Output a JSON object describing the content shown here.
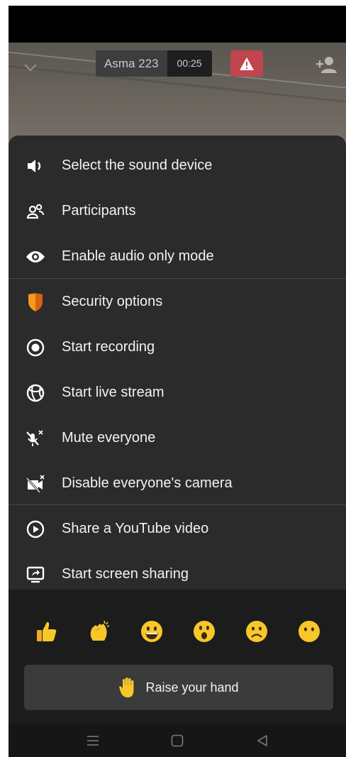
{
  "call": {
    "participant_name": "Asma 223",
    "timer": "00:25"
  },
  "menu": {
    "items": [
      {
        "label": "Select the sound device",
        "icon": "speaker-icon"
      },
      {
        "label": "Participants",
        "icon": "participants-icon"
      },
      {
        "label": "Enable audio only mode",
        "icon": "eye-icon"
      },
      {
        "label": "Security options",
        "icon": "shield-icon"
      },
      {
        "label": "Start recording",
        "icon": "record-icon"
      },
      {
        "label": "Start live stream",
        "icon": "live-stream-icon"
      },
      {
        "label": "Mute everyone",
        "icon": "mic-off-icon"
      },
      {
        "label": "Disable everyone's camera",
        "icon": "camera-off-icon"
      },
      {
        "label": "Share a YouTube video",
        "icon": "play-circle-icon"
      },
      {
        "label": "Start screen sharing",
        "icon": "screen-share-icon"
      }
    ]
  },
  "reactions": {
    "emojis": [
      "thumbs-up",
      "clapping-hands",
      "grinning-face",
      "surprised-face",
      "frowning-face",
      "neutral-face"
    ]
  },
  "raise_hand": {
    "label": "Raise your hand"
  },
  "colors": {
    "sheet_bg": "#2b2b2b",
    "reactions_bg": "#1c1c1c",
    "warning_red": "#c0454c",
    "shield_orange": "#f29b1d",
    "emoji_yellow": "#f7c72a"
  }
}
